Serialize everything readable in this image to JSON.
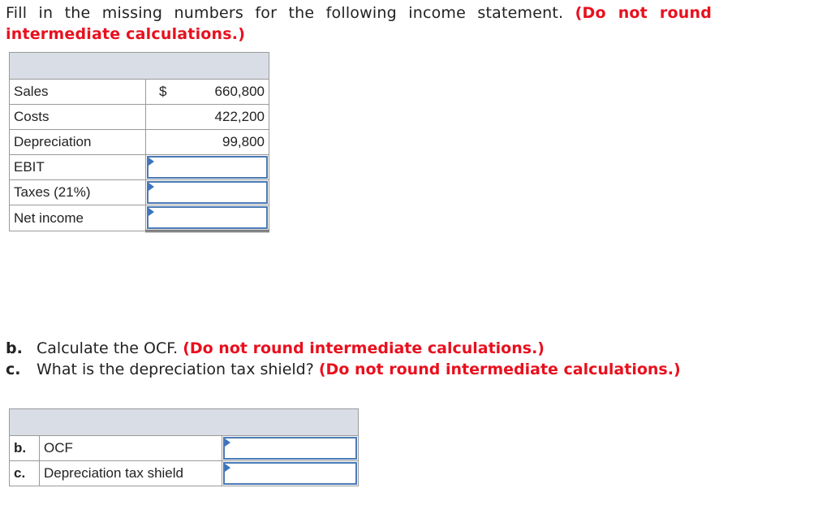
{
  "prompt": {
    "text": "Fill in the missing numbers for the following income statement.",
    "emphasis": "(Do not round intermediate calculations.)"
  },
  "income_statement": {
    "currency_symbol": "$",
    "rows": [
      {
        "label": "Sales",
        "value": "660,800"
      },
      {
        "label": "Costs",
        "value": "422,200"
      },
      {
        "label": "Depreciation",
        "value": "99,800"
      },
      {
        "label": "EBIT",
        "value": ""
      },
      {
        "label": "Taxes (21%)",
        "value": ""
      },
      {
        "label": "Net income",
        "value": ""
      }
    ]
  },
  "parts": [
    {
      "letter": "b.",
      "text": "Calculate the OCF.",
      "emphasis": "(Do not round intermediate calculations.)"
    },
    {
      "letter": "c.",
      "text": "What is the depreciation tax shield?",
      "emphasis": "(Do not round intermediate calculations.)"
    }
  ],
  "answer_table": {
    "rows": [
      {
        "letter": "b.",
        "label": "OCF",
        "value": ""
      },
      {
        "letter": "c.",
        "label": "Depreciation tax shield",
        "value": ""
      }
    ]
  },
  "colors": {
    "emphasis": "#e8101e",
    "input_border": "#4a7ab5",
    "header_fill": "#d9dee6"
  }
}
